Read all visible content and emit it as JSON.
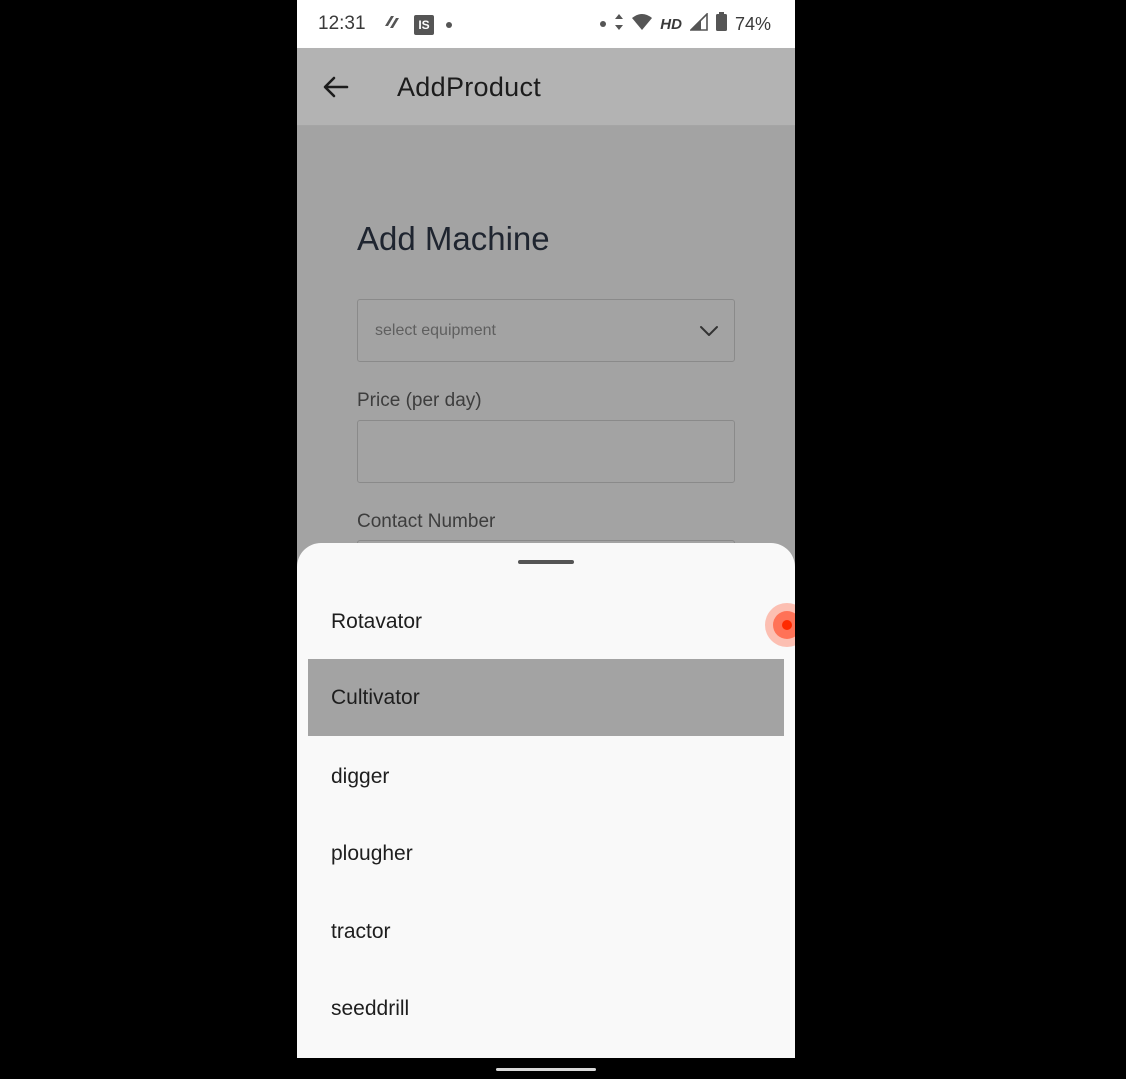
{
  "status_bar": {
    "time": "12:31",
    "network": "HD",
    "battery": "74%",
    "badge": "IS"
  },
  "app_bar": {
    "title": "AddProduct"
  },
  "form": {
    "heading": "Add Machine",
    "equipment_placeholder": "select equipment",
    "price_label": "Price (per day)",
    "contact_label": "Contact Number"
  },
  "equipment_options": [
    {
      "label": "Rotavator"
    },
    {
      "label": "Cultivator"
    },
    {
      "label": "digger"
    },
    {
      "label": "plougher"
    },
    {
      "label": "tractor"
    },
    {
      "label": "seeddrill"
    }
  ],
  "highlighted_option": "Cultivator",
  "colors": {
    "sheet_bg": "#f9f9f9",
    "highlight_bg": "#a3a3a3",
    "scrim_bg": "#a3a3a3",
    "touch_indicator": "#ff2a00"
  }
}
